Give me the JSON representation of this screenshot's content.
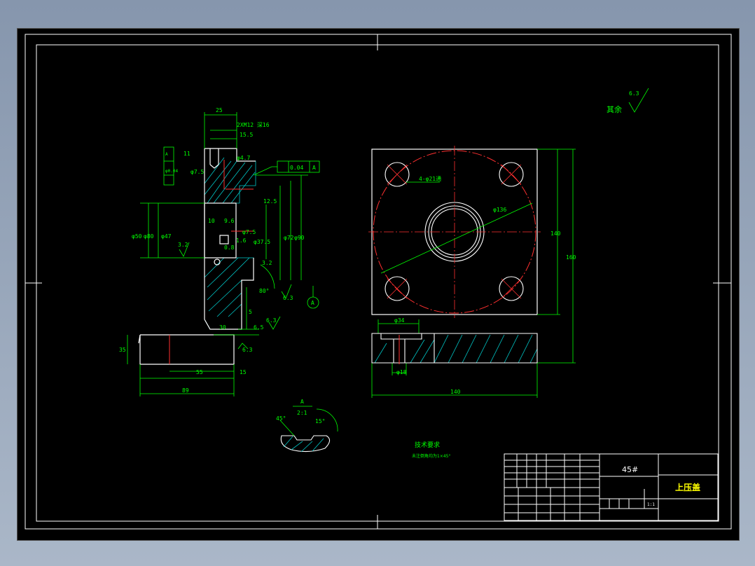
{
  "drawing": {
    "title_material": "45#",
    "title_name": "上压盖",
    "scale": "1:1",
    "surface_finish_note": "其余",
    "surface_finish_value": "6.3",
    "tech_req_title": "技术要求",
    "tech_req_text": "未注倒角均为1×45°"
  },
  "section_view": {
    "dims": {
      "d25": "25",
      "thread": "2XM12 深16",
      "d15_5": "15.5",
      "d11": "11",
      "d_phi4_7": "φ4.7",
      "d_phi7_5a": "φ7.5",
      "d_phi7_5b": "φ7.5",
      "d_phi37": "φ37.5",
      "d10": "10",
      "d9_6": "9.6",
      "d1_6": "1.6",
      "d0_8": "0.8",
      "d12_5": "12.5",
      "d_phi50": "φ50",
      "d_phi80": "φ80",
      "d_phi47": "φ47",
      "d_phi72": "φ72",
      "d_phi90": "φ90",
      "d30": "30",
      "d6_5": "6.5",
      "d5": "5",
      "d80deg": "80°",
      "d6_3a": "6.3",
      "d6_3b": "6.3",
      "d6_3c": "6.3",
      "d3_2": "3.2",
      "d3_2b": "3.2",
      "d55": "55",
      "d15": "15",
      "d89": "89",
      "d35": "35",
      "flatness": "0.04",
      "flatness_datum": "A",
      "coax": "φ0.04",
      "coax_datum": "A",
      "datum_a": "A"
    }
  },
  "top_view": {
    "holes_label": "4-φ21通",
    "pcd_label": "φ136",
    "d140_vert": "140",
    "d160_vert": "160",
    "d34": "φ34",
    "d18": "φ18",
    "d140_horiz": "140"
  },
  "detail": {
    "label": "A",
    "scale": "2:1",
    "angle1": "45°",
    "angle2": "15°"
  },
  "colors": {
    "sheet": "#000000",
    "frame": "#ffffff",
    "dim": "#00ff00",
    "center": "#ff0000",
    "hatch": "#00c8c8",
    "text_yellow": "#ffff00"
  }
}
